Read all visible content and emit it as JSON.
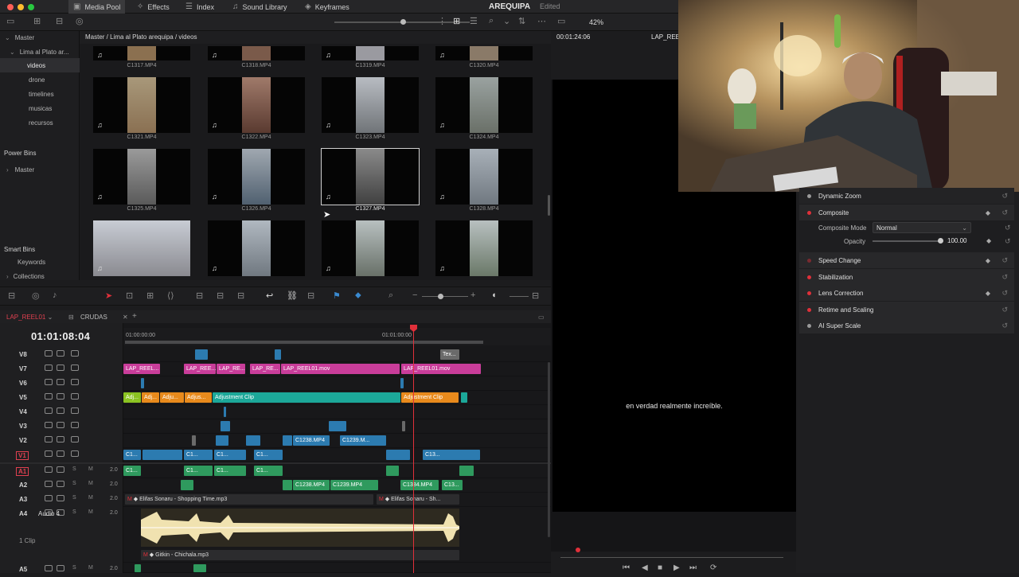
{
  "app": {
    "title": "AREQUIPA",
    "edit_state": "Edited",
    "zoom": "42%"
  },
  "top_tabs": [
    {
      "label": "Media Pool",
      "icon": "media-pool-icon",
      "active": true
    },
    {
      "label": "Effects",
      "icon": "effects-icon"
    },
    {
      "label": "Index",
      "icon": "index-icon"
    },
    {
      "label": "Sound Library",
      "icon": "sound-library-icon"
    },
    {
      "label": "Keyframes",
      "icon": "keyframes-icon"
    }
  ],
  "sidebar": {
    "master": "Master",
    "project": "Lima al Plato ar...",
    "items": [
      "videos",
      "drone",
      "timelines",
      "musicas",
      "recursos"
    ],
    "power_bins": "Power Bins",
    "power_master": "Master",
    "smart_bins": "Smart Bins",
    "keywords": "Keywords",
    "collections": "Collections"
  },
  "path": "Master / Lima al Plato arequipa / videos",
  "clips": [
    [
      "C1317.MP4",
      "C1318.MP4",
      "C1319.MP4",
      "C1320.MP4"
    ],
    [
      "C1321.MP4",
      "C1322.MP4",
      "C1323.MP4",
      "C1324.MP4"
    ],
    [
      "C1325.MP4",
      "C1326.MP4",
      "C1327.MP4",
      "C1328.MP4"
    ]
  ],
  "viewer": {
    "timecode": "00:01:24:06",
    "clip_name": "LAP_REEL",
    "subtitle": "en verdad realmente increíble."
  },
  "inspector": {
    "dynamic_zoom": "Dynamic Zoom",
    "composite": "Composite",
    "composite_mode_label": "Composite Mode",
    "composite_mode_value": "Normal",
    "opacity_label": "Opacity",
    "opacity_value": "100.00",
    "speed_change": "Speed Change",
    "stabilization": "Stabilization",
    "lens_correction": "Lens Correction",
    "retime_scaling": "Retime and Scaling",
    "ai_super_scale": "AI Super Scale"
  },
  "timeline": {
    "tab1": "LAP_REEL01",
    "tab2": "CRUDAS",
    "timecode": "01:01:08:04",
    "ruler": [
      "01:00:00:00",
      "01:01:00:00"
    ],
    "tracks": [
      "V8",
      "V7",
      "V6",
      "V5",
      "V4",
      "V3",
      "V2",
      "V1",
      "A1",
      "A2",
      "A3",
      "A4",
      "A5"
    ],
    "audio_level": "2.0",
    "audio4_name": "Audio 4",
    "audio4_clips": "1 Clip",
    "v7": [
      "LAP_REEL...",
      "LAP_REE...",
      "LAP_RE...",
      "LAP_RE...",
      "LAP_REEL01.mov",
      "LAP_REEL01.mov"
    ],
    "v8_text": "Tex...",
    "v5": [
      "Adj...",
      "Adj...",
      "Adju...",
      "Adjus...",
      "Adjustment Clip",
      "Adjustment Clip"
    ],
    "v2": [
      "C1238.MP4",
      "C1239.M..."
    ],
    "v1": [
      "C1...",
      "C1...",
      "C1...",
      "C1...",
      "C13..."
    ],
    "a1": [
      "C1...",
      "C1...",
      "C1...",
      "C1..."
    ],
    "a2": [
      "C1238.MP4",
      "C1239.MP4",
      "C1384.MP4",
      "C13..."
    ],
    "a3": [
      "Elifas Sonaru - Shopping Time.mp3",
      "Elifas Sonaru - Sh..."
    ],
    "a4_clip": "Gitkin - Chichala.mp3"
  },
  "colors": {
    "pink": "#c93d9a",
    "blue": "#2c7bb0",
    "teal": "#1ca899",
    "orange": "#e88a1c",
    "green": "#2f9a5e",
    "playhead": "#e0303a"
  }
}
